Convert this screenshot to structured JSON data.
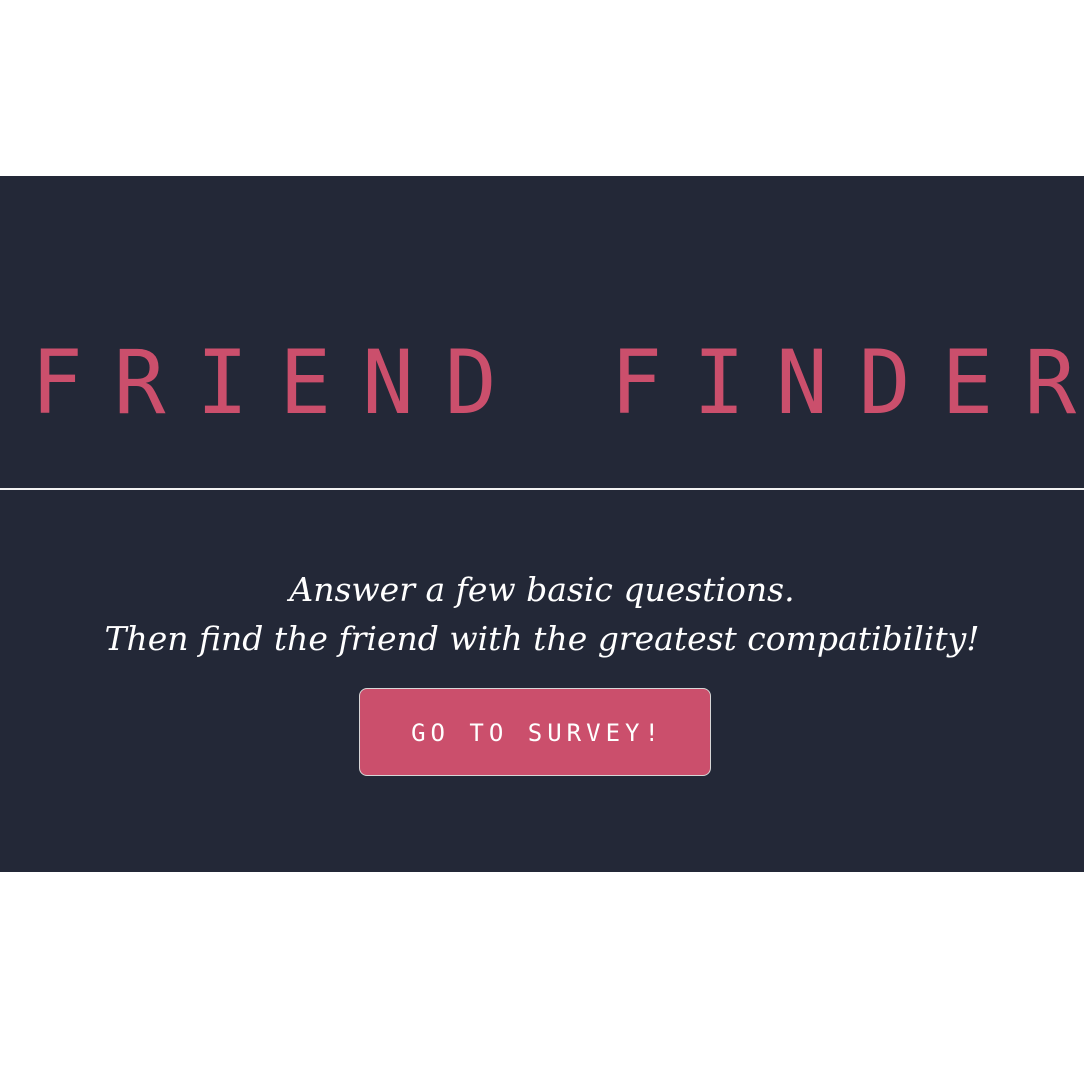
{
  "app": {
    "title": "FRIEND FINDER"
  },
  "hero": {
    "tagline_line_1": "Answer a few basic questions.",
    "tagline_line_2": "Then find the friend with the greatest compatibility!",
    "cta_label": "GO TO SURVEY!"
  },
  "colors": {
    "background": "#ffffff",
    "panel": "#232837",
    "accent": "#cb4f6c",
    "text": "#ffffff",
    "divider": "#f2f2f2"
  }
}
